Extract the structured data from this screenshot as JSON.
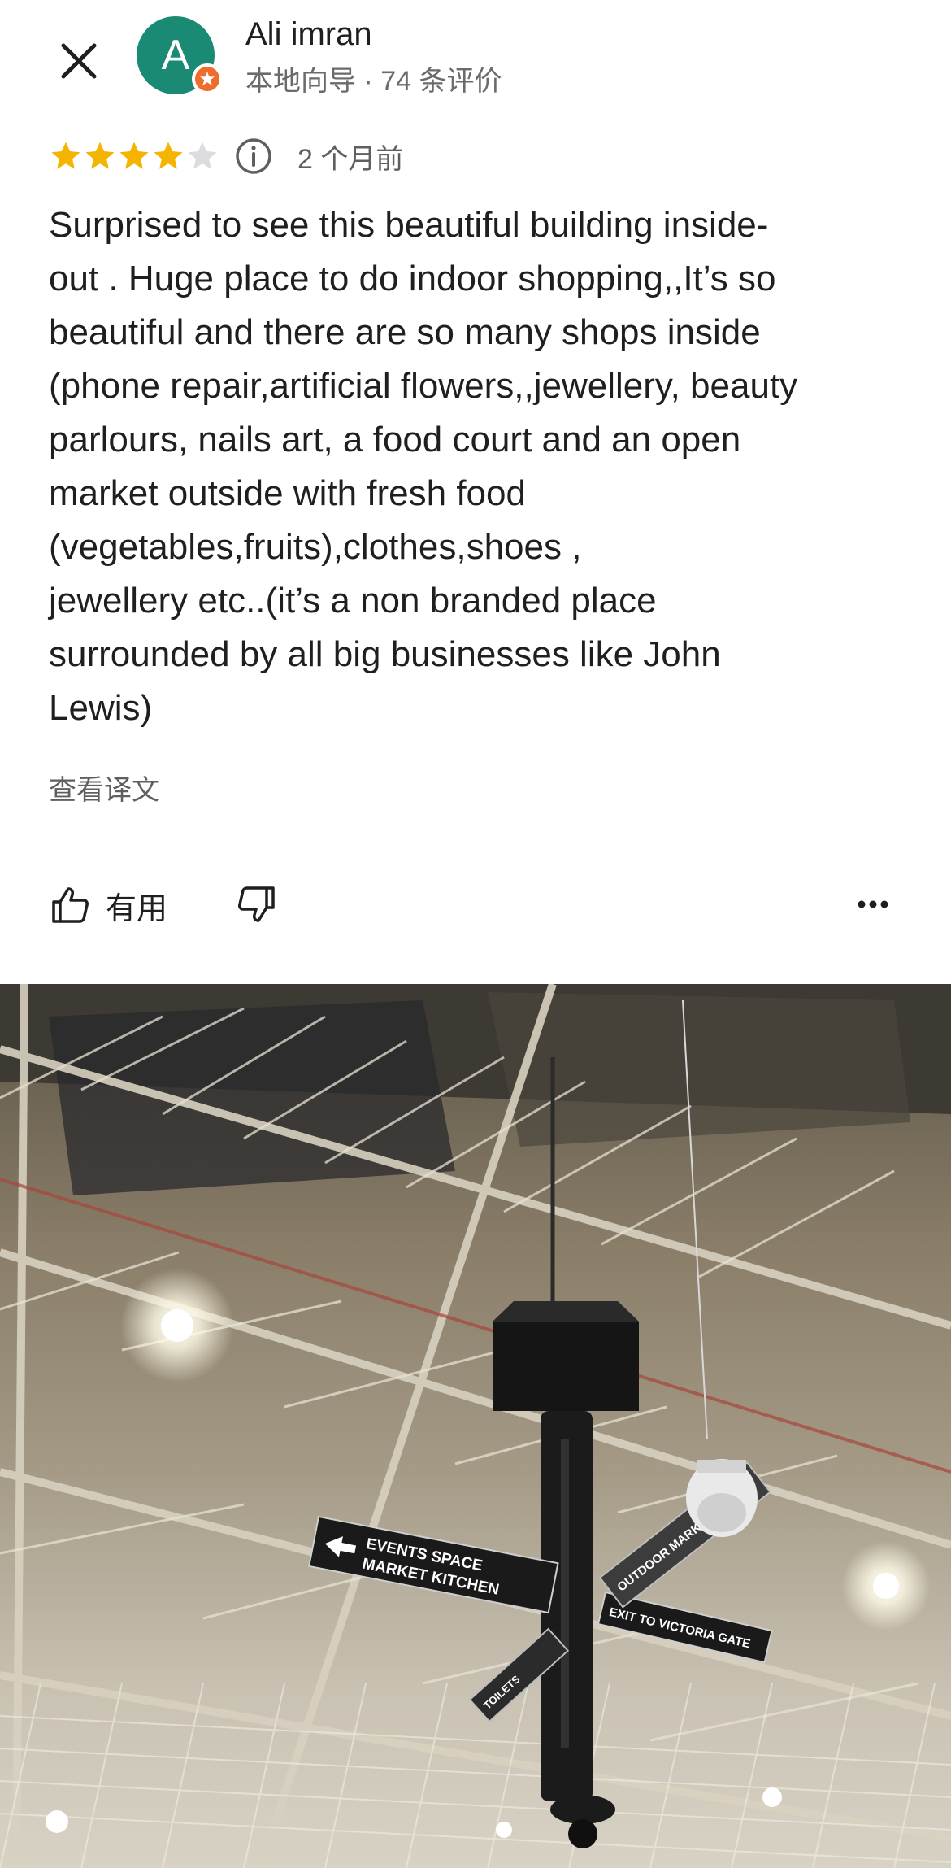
{
  "header": {
    "close_icon": "close-icon",
    "avatar_letter": "A",
    "user_name": "Ali imran",
    "user_subtitle": "本地向导 · 74 条评价",
    "badge_icon": "local-guide-star-icon"
  },
  "review": {
    "rating": 4,
    "rating_max": 5,
    "star_color": "#f4b400",
    "info_icon": "info-icon",
    "time_ago": "2 个月前",
    "text": "Surprised to see this beautiful building inside-\nout . Huge place to do indoor shopping,,It’s so\nbeautiful and there are so many shops inside\n(phone repair,artificial flowers,,jewellery, beauty\nparlours, nails art,  a food court and an open\nmarket outside with fresh food\n(vegetables,fruits),clothes,shoes ,\njewellery etc..(it’s a non branded place\nsurrounded by all big businesses  like John\nLewis)",
    "translate_label": "查看译文"
  },
  "actions": {
    "helpful_label": "有用",
    "helpful_icon": "thumbs-up-icon",
    "unhelpful_icon": "thumbs-down-icon",
    "more_icon": "more-horizontal-icon"
  },
  "photo": {
    "signs": {
      "events_line1": "EVENTS SPACE",
      "events_line2": "MARKET KITCHEN",
      "exit": "EXIT TO VICTORIA GATE",
      "outdoor": "OUTDOOR MARKET",
      "toilets": "TOILETS"
    }
  }
}
